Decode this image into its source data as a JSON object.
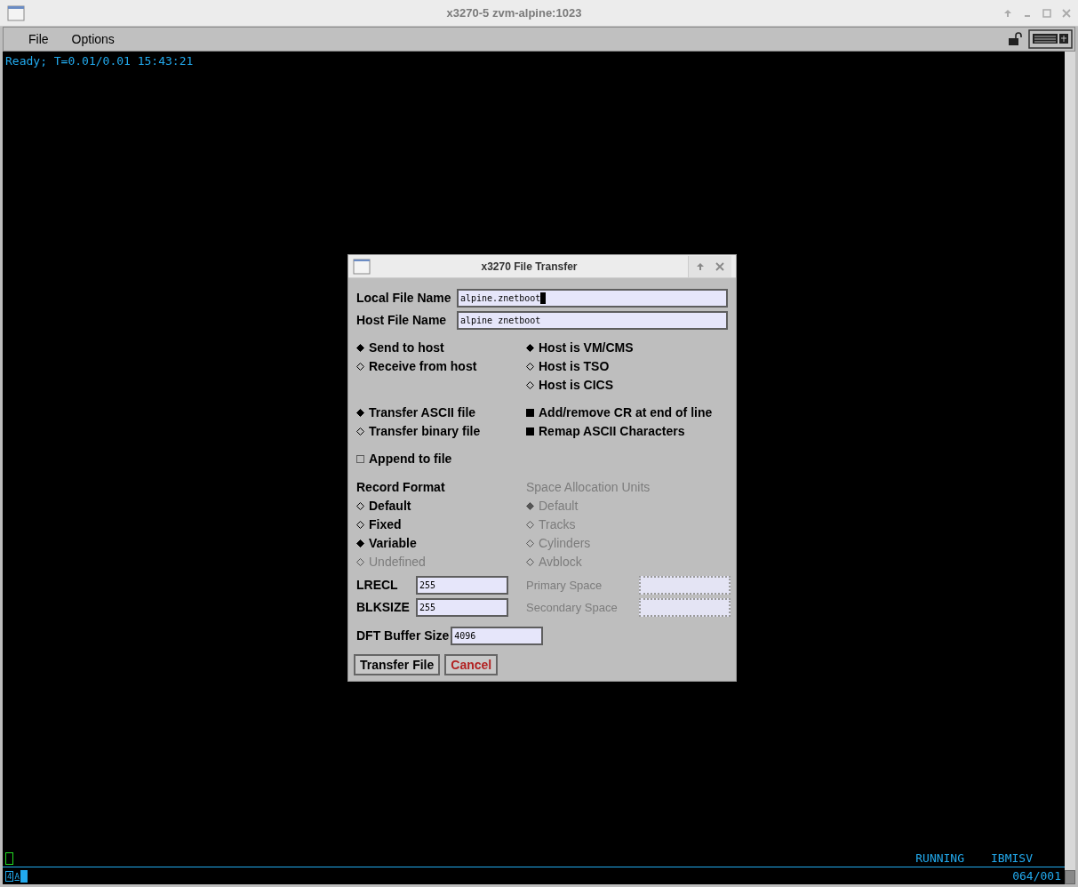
{
  "window": {
    "title": "x3270-5 zvm-alpine:1023"
  },
  "menu": [
    "File",
    "Options"
  ],
  "terminal": {
    "status_line": "Ready; T=0.01/0.01 15:43:21",
    "mode": "RUNNING",
    "system": "IBMISV",
    "oia_indicator": "4",
    "oia_mode": "A",
    "cursor_position": "064/001"
  },
  "dialog": {
    "title": "x3270 File Transfer",
    "files": [
      {
        "label": "Local File Name",
        "value": "alpine.znetboot",
        "cursor": true
      },
      {
        "label": "Host File Name",
        "value": "alpine znetboot",
        "cursor": false
      }
    ],
    "direction": [
      {
        "label": "Send to host",
        "selected": true
      },
      {
        "label": "Receive from host",
        "selected": false
      }
    ],
    "host_type": [
      {
        "label": "Host is VM/CMS",
        "selected": true
      },
      {
        "label": "Host is TSO",
        "selected": false
      },
      {
        "label": "Host is CICS",
        "selected": false
      }
    ],
    "transfer_mode": [
      {
        "label": "Transfer ASCII file",
        "selected": true
      },
      {
        "label": "Transfer binary file",
        "selected": false
      }
    ],
    "conversions": [
      {
        "label": "Add/remove CR at end of line",
        "checked": true
      },
      {
        "label": "Remap ASCII Characters",
        "checked": true
      }
    ],
    "append": {
      "label": "Append to file",
      "checked": false
    },
    "record_format": {
      "heading": "Record Format",
      "disabled": false,
      "options": [
        {
          "label": "Default",
          "selected": false,
          "disabled": false
        },
        {
          "label": "Fixed",
          "selected": false,
          "disabled": false
        },
        {
          "label": "Variable",
          "selected": true,
          "disabled": false
        },
        {
          "label": "Undefined",
          "selected": false,
          "disabled": true
        }
      ]
    },
    "space_allocation": {
      "heading": "Space Allocation Units",
      "disabled": true,
      "options": [
        {
          "label": "Default",
          "selected": true,
          "disabled": true
        },
        {
          "label": "Tracks",
          "selected": false,
          "disabled": true
        },
        {
          "label": "Cylinders",
          "selected": false,
          "disabled": true
        },
        {
          "label": "Avblock",
          "selected": false,
          "disabled": true
        }
      ]
    },
    "size_fields": [
      {
        "label": "LRECL",
        "value": "255",
        "disabled": false
      },
      {
        "label": "BLKSIZE",
        "value": "255",
        "disabled": false
      }
    ],
    "space_fields": [
      {
        "label": "Primary Space",
        "disabled": true
      },
      {
        "label": "Secondary Space",
        "disabled": true
      }
    ],
    "buffer": {
      "label": "DFT Buffer Size",
      "value": "4096"
    },
    "buttons": [
      {
        "label": "Transfer File",
        "kind": "default"
      },
      {
        "label": "Cancel",
        "kind": "cancel"
      }
    ]
  }
}
